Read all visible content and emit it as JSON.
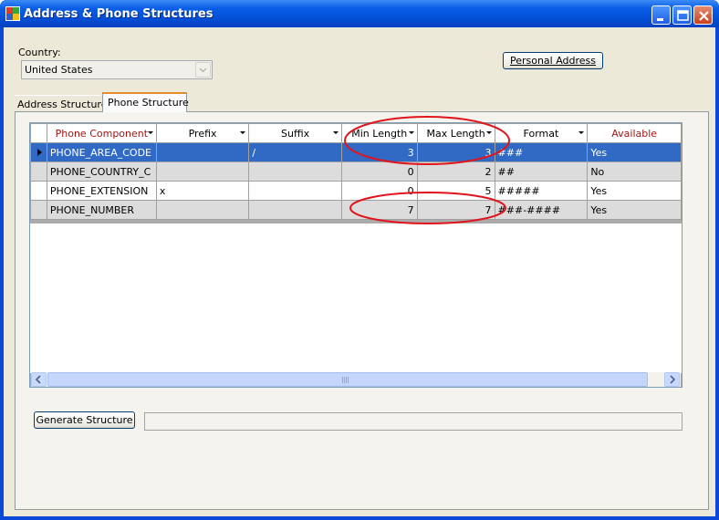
{
  "window": {
    "title": "Address & Phone Structures"
  },
  "country": {
    "label": "Country:",
    "selected": "United States"
  },
  "buttons": {
    "personal_address": "Personal Address",
    "generate_structure": "Generate Structure"
  },
  "tabs": [
    {
      "label": "Address Structure",
      "active": false
    },
    {
      "label": "Phone Structure",
      "active": true
    }
  ],
  "grid": {
    "columns": [
      "Phone Component",
      "Prefix",
      "Suffix",
      "Min Length",
      "Max Length",
      "Format",
      "Available"
    ],
    "rows": [
      {
        "component": "PHONE_AREA_CODE",
        "prefix": "",
        "suffix": "/",
        "min": "3",
        "max": "3",
        "format": "###",
        "available": "Yes"
      },
      {
        "component": "PHONE_COUNTRY_C",
        "prefix": "",
        "suffix": "",
        "min": "0",
        "max": "2",
        "format": "##",
        "available": "No"
      },
      {
        "component": "PHONE_EXTENSION",
        "prefix": "x",
        "suffix": "",
        "min": "0",
        "max": "5",
        "format": "#####",
        "available": "Yes"
      },
      {
        "component": "PHONE_NUMBER",
        "prefix": "",
        "suffix": "",
        "min": "7",
        "max": "7",
        "format": "###-####",
        "available": "Yes"
      }
    ],
    "selected_row": 0
  },
  "colors": {
    "title_bar": "#0a5ee6",
    "selection": "#316ac5",
    "header_red": "#a31515",
    "annotation": "#e0151c"
  }
}
